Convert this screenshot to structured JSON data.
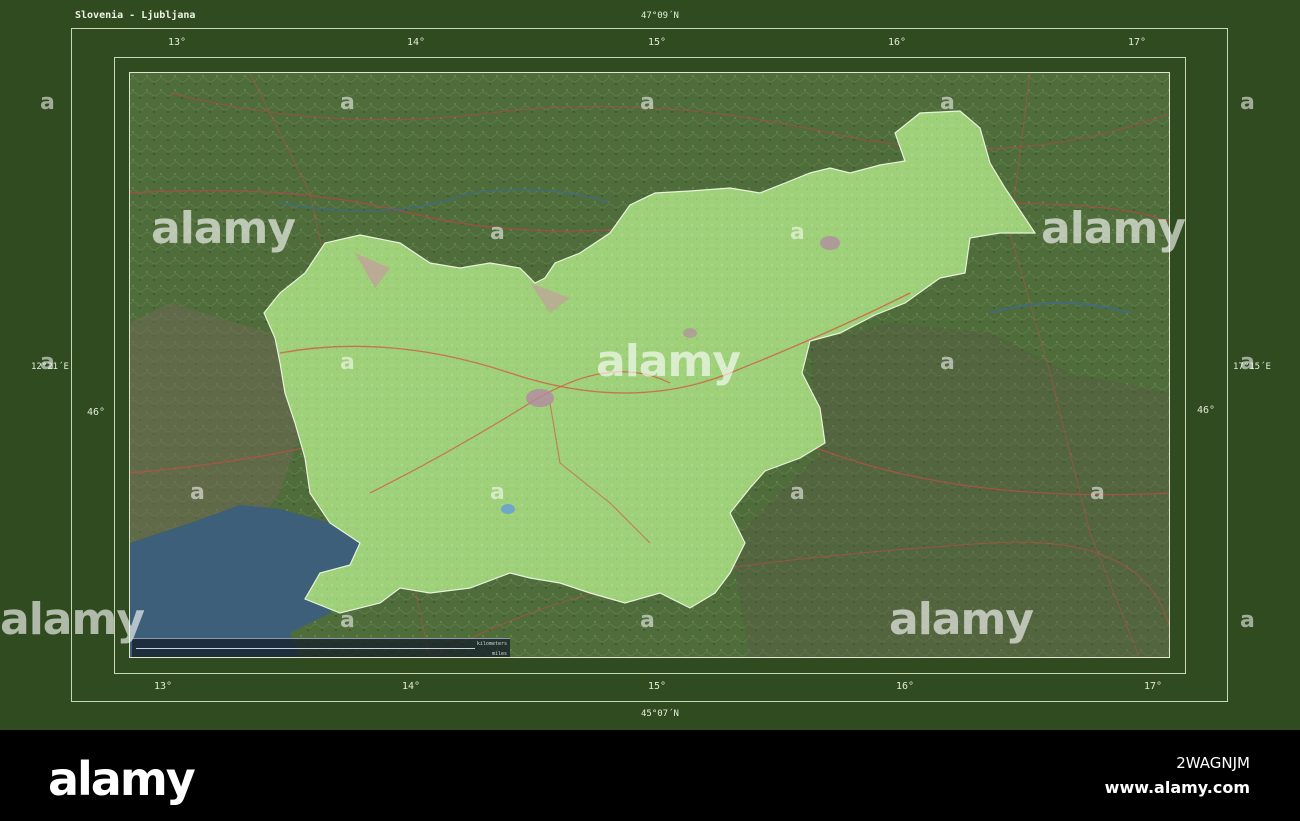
{
  "map": {
    "title": "Slovenia - Ljubljana",
    "top_lat": "47°09´N",
    "bottom_lat": "45°07´N",
    "left_lon": "12°21´E",
    "right_lon": "17°15´E",
    "lon_ticks_top": [
      "13°",
      "14°",
      "15°",
      "16°",
      "17°"
    ],
    "lon_ticks_bottom": [
      "13°",
      "14°",
      "15°",
      "16°",
      "17°"
    ],
    "lat_tick_left": "46°",
    "lat_tick_right": "46°",
    "scale": {
      "units_top": "kilometers",
      "units_bottom": "miles"
    },
    "colors": {
      "frame": "#2f4b1f",
      "highlight": "#9fd07a",
      "sea": "#3d5f7a",
      "surrounding": "#4d6a3a"
    }
  },
  "watermark": {
    "text": "alamy",
    "badge": "a"
  },
  "footer": {
    "logo": "alamy",
    "image_id": "2WAGNJM",
    "url": "www.alamy.com"
  }
}
